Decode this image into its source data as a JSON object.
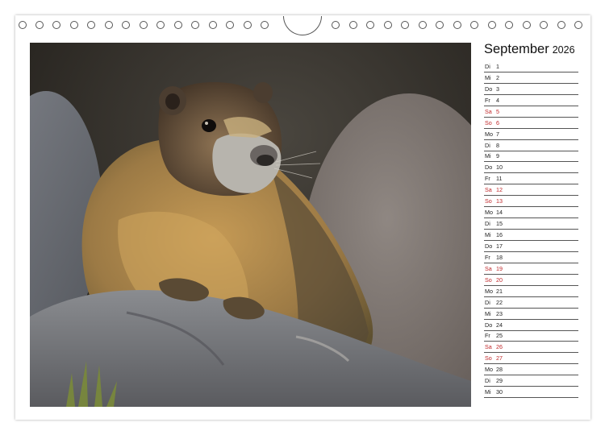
{
  "calendar": {
    "month": "September",
    "year": "2026",
    "days": [
      {
        "dn": "Di",
        "d": "1",
        "we": false
      },
      {
        "dn": "Mi",
        "d": "2",
        "we": false
      },
      {
        "dn": "Do",
        "d": "3",
        "we": false
      },
      {
        "dn": "Fr",
        "d": "4",
        "we": false
      },
      {
        "dn": "Sa",
        "d": "5",
        "we": true
      },
      {
        "dn": "So",
        "d": "6",
        "we": true
      },
      {
        "dn": "Mo",
        "d": "7",
        "we": false
      },
      {
        "dn": "Di",
        "d": "8",
        "we": false
      },
      {
        "dn": "Mi",
        "d": "9",
        "we": false
      },
      {
        "dn": "Do",
        "d": "10",
        "we": false
      },
      {
        "dn": "Fr",
        "d": "11",
        "we": false
      },
      {
        "dn": "Sa",
        "d": "12",
        "we": true
      },
      {
        "dn": "So",
        "d": "13",
        "we": true
      },
      {
        "dn": "Mo",
        "d": "14",
        "we": false
      },
      {
        "dn": "Di",
        "d": "15",
        "we": false
      },
      {
        "dn": "Mi",
        "d": "16",
        "we": false
      },
      {
        "dn": "Do",
        "d": "17",
        "we": false
      },
      {
        "dn": "Fr",
        "d": "18",
        "we": false
      },
      {
        "dn": "Sa",
        "d": "19",
        "we": true
      },
      {
        "dn": "So",
        "d": "20",
        "we": true
      },
      {
        "dn": "Mo",
        "d": "21",
        "we": false
      },
      {
        "dn": "Di",
        "d": "22",
        "we": false
      },
      {
        "dn": "Mi",
        "d": "23",
        "we": false
      },
      {
        "dn": "Do",
        "d": "24",
        "we": false
      },
      {
        "dn": "Fr",
        "d": "25",
        "we": false
      },
      {
        "dn": "Sa",
        "d": "26",
        "we": true
      },
      {
        "dn": "So",
        "d": "27",
        "we": true
      },
      {
        "dn": "Mo",
        "d": "28",
        "we": false
      },
      {
        "dn": "Di",
        "d": "29",
        "we": false
      },
      {
        "dn": "Mi",
        "d": "30",
        "we": false
      }
    ]
  },
  "colors": {
    "weekend": "#c0282a",
    "weekday": "#222222"
  },
  "photo": {
    "subject": "marmot-on-rock"
  }
}
